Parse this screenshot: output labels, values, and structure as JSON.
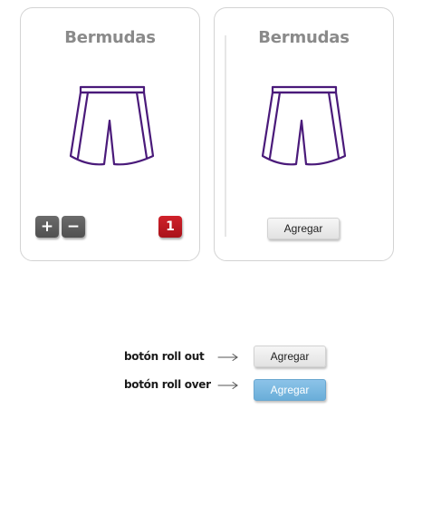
{
  "products": [
    {
      "title": "Bermudas",
      "icon": "shorts-icon",
      "plus_label": "+",
      "minus_label": "−",
      "quantity": "1"
    },
    {
      "title": "Bermudas",
      "icon": "shorts-icon",
      "add_button_label": "Agregar"
    }
  ],
  "legend": {
    "roll_out_label": "botón roll out",
    "roll_over_label": "botón roll over",
    "roll_out_button_label": "Agregar",
    "roll_over_button_label": "Agregar",
    "arrow_icon": "long-arrow-right-icon"
  },
  "colors": {
    "shorts_stroke": "#4a1a7a",
    "title_gray": "#8a8a8a",
    "qty_button": "#5c5c5c",
    "qty_badge": "#c0181f",
    "button_rollout": "#ececec",
    "button_rollover": "#7bb8e0"
  }
}
